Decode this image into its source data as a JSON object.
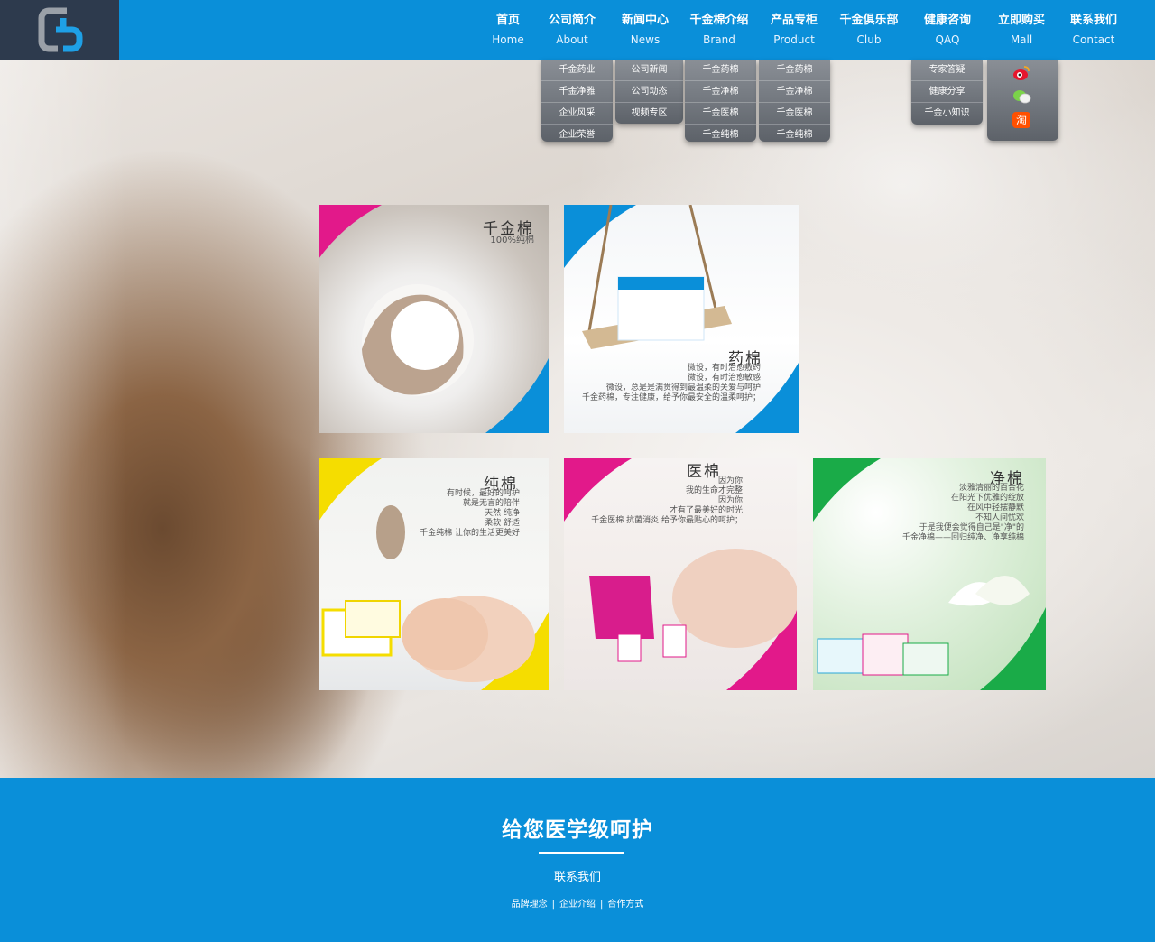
{
  "nav": [
    {
      "cn": "首页",
      "en": "Home"
    },
    {
      "cn": "公司简介",
      "en": "About"
    },
    {
      "cn": "新闻中心",
      "en": "News"
    },
    {
      "cn": "千金棉介绍",
      "en": "Brand"
    },
    {
      "cn": "产品专柜",
      "en": "Product"
    },
    {
      "cn": "千金俱乐部",
      "en": "Club"
    },
    {
      "cn": "健康咨询",
      "en": "QAQ"
    },
    {
      "cn": "立即购买",
      "en": "Mall"
    },
    {
      "cn": "联系我们",
      "en": "Contact"
    }
  ],
  "dropdowns": {
    "about": [
      "千金药业",
      "千金净雅",
      "企业风采",
      "企业荣誉"
    ],
    "news": [
      "公司新闻",
      "公司动态",
      "视频专区"
    ],
    "brand": [
      "千金药棉",
      "千金净棉",
      "千金医棉",
      "千金纯棉"
    ],
    "product": [
      "千金药棉",
      "千金净棉",
      "千金医棉",
      "千金纯棉"
    ],
    "qaq": [
      "专家答疑",
      "健康分享",
      "千金小知识"
    ]
  },
  "social": {
    "weibo": "weibo-icon",
    "wechat": "wechat-icon",
    "taobao": "淘"
  },
  "cards": [
    {
      "title": "千金棉",
      "sub": "100%纯棉",
      "lines": []
    },
    {
      "title": "药棉",
      "sub": "",
      "lines": [
        "微设，有时治愈敷药",
        "微设，有时治愈敏感",
        "微设，总是是满贯得到最温柔的关爱与呵护",
        "千金药棉，专注健康，给予你最安全的温柔呵护；"
      ]
    },
    {
      "title": "纯棉",
      "sub": "",
      "lines": [
        "有时候，最好的呵护",
        "就是无言的陪伴",
        "天然 纯净",
        "柔软 舒适",
        "千金纯棉 让你的生活更美好"
      ]
    },
    {
      "title": "医棉",
      "sub": "",
      "lines": [
        "因为你",
        "我的生命才完整",
        "因为你",
        "才有了最美好的时光",
        "千金医棉 抗菌消炎 给予你最贴心的呵护；"
      ]
    },
    {
      "title": "净棉",
      "sub": "",
      "lines": [
        "淡雅清丽的百合花",
        "在阳光下优雅的绽放",
        "在风中轻摆静默",
        "不知人间忧欢",
        "于是我便会觉得自己是\"净\"的",
        "千金净棉——回归纯净、净享纯棉"
      ]
    }
  ],
  "footer": {
    "slogan": "给您医学级呵护",
    "contact": "联系我们",
    "links": [
      "品牌理念",
      "企业介绍",
      "合作方式"
    ],
    "separator": "|"
  },
  "colors": {
    "brand_blue": "#0a8fd9",
    "logo_bg": "#2d3a4d",
    "magenta": "#e2198a",
    "yellow": "#f5dd00",
    "green": "#1aab48"
  }
}
